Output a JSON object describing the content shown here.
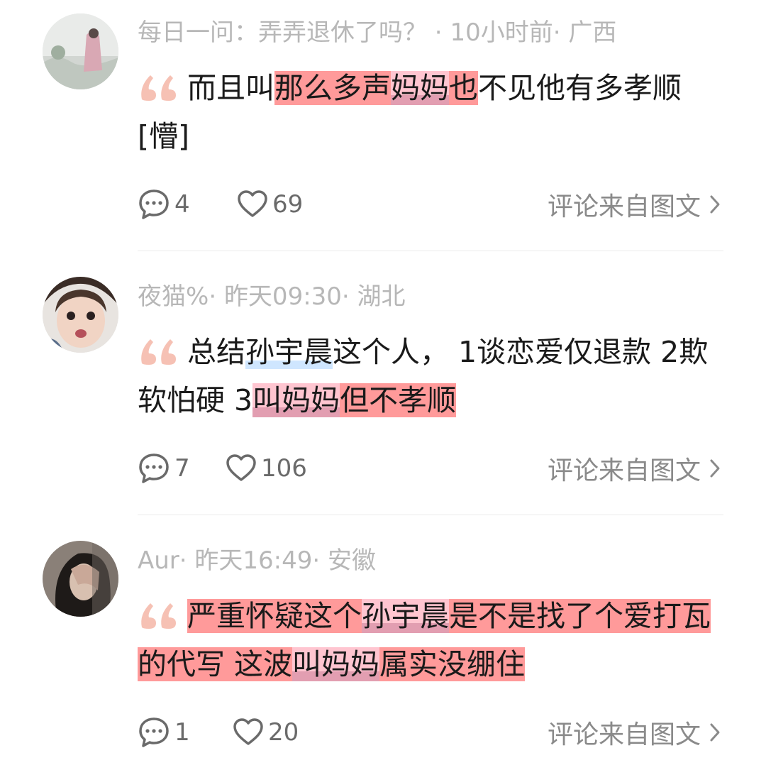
{
  "comments": [
    {
      "user": "每日一问：弄弄退休了吗？",
      "time": "10小时前",
      "region": "广西",
      "segments": [
        {
          "text": "而且叫",
          "style": ""
        },
        {
          "text": "那么多声",
          "style": "red"
        },
        {
          "text": "妈妈",
          "style": "pink"
        },
        {
          "text": "也",
          "style": "red"
        },
        {
          "text": "不见他有多孝顺[懵]",
          "style": ""
        }
      ],
      "replies": "4",
      "likes": "69",
      "source": "评论来自图文"
    },
    {
      "user": "夜猫%",
      "time": "昨天09:30",
      "region": "湖北",
      "segments": [
        {
          "text": "总结",
          "style": ""
        },
        {
          "text": "孙宇晨",
          "style": "blue"
        },
        {
          "text": "这个人， 1谈恋爱仅退款 2欺软怕硬 3",
          "style": ""
        },
        {
          "text": "叫妈妈",
          "style": "pink"
        },
        {
          "text": "但不孝顺",
          "style": "red"
        }
      ],
      "replies": "7",
      "likes": "106",
      "source": "评论来自图文"
    },
    {
      "user": "Aur",
      "time": "昨天16:49",
      "region": "安徽",
      "segments": [
        {
          "text": "严重怀疑这个",
          "style": "red"
        },
        {
          "text": "孙宇晨",
          "style": "pink"
        },
        {
          "text": "是不是找了个爱打瓦的代写 这波",
          "style": "red"
        },
        {
          "text": "叫妈妈",
          "style": "pink"
        },
        {
          "text": "属实没绷住",
          "style": "red"
        }
      ],
      "replies": "1",
      "likes": "20",
      "source": "评论来自图文"
    }
  ],
  "colors": {
    "meta": "#b7b7b7",
    "text": "#1a1a1a",
    "highlight_red": "#ff7878",
    "quote_mark": "#f6c1b4"
  },
  "icons": [
    "comment-bubble-icon",
    "heart-icon",
    "chevron-right-icon",
    "quote-mark-icon"
  ]
}
